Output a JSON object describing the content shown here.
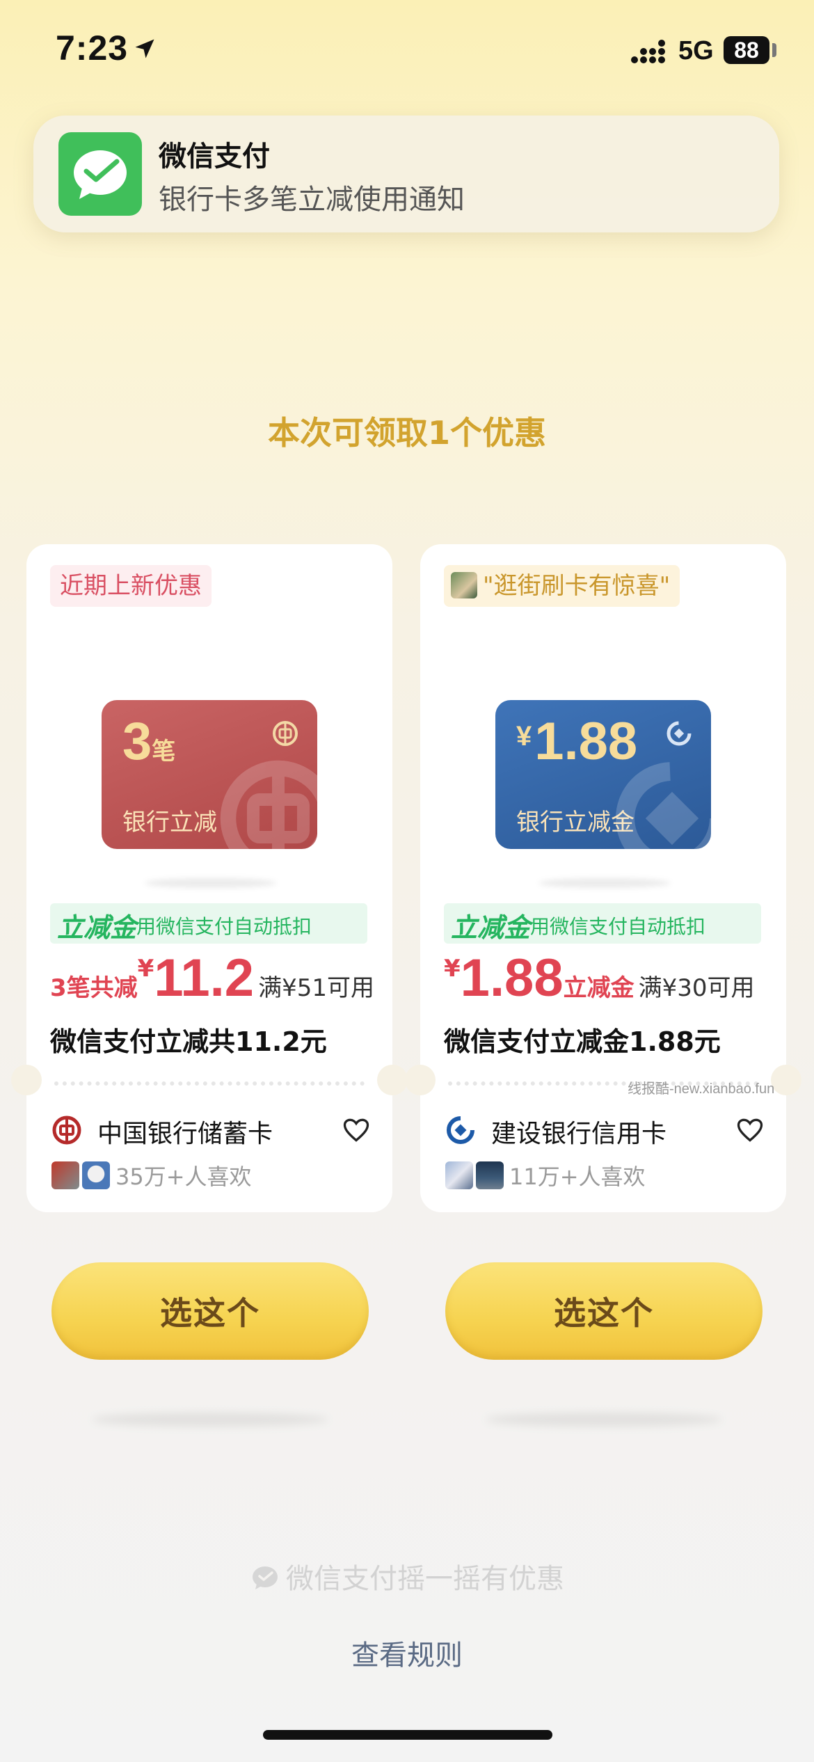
{
  "status_bar": {
    "time": "7:23",
    "network": "5G",
    "battery": "88"
  },
  "notification": {
    "title": "微信支付",
    "body": "银行卡多笔立减使用通知",
    "icon": "wechat-pay-icon",
    "icon_color": "#40bf5a"
  },
  "headline": "本次可领取1个优惠",
  "cards": [
    {
      "tag": "近期上新优惠",
      "bank_card_big": "3",
      "bank_card_big_small": "笔",
      "bank_card_label": "银行立减",
      "feature_strong": "立减金",
      "feature_sub": "用微信支付自动抵扣",
      "price_prefix": "3笔共减",
      "price_yen": "¥",
      "price_num": "11.2",
      "price_suffix": "",
      "price_cond": "满¥51可用",
      "desc": "微信支付立减共11.2元",
      "bank_name": "中国银行储蓄卡",
      "likes": "35万+人喜欢",
      "card_color": "#c05858"
    },
    {
      "tag": "\"逛街刷卡有惊喜\"",
      "bank_card_yen": "¥",
      "bank_card_big": "1.88",
      "bank_card_label": "银行立减金",
      "feature_strong": "立减金",
      "feature_sub": "用微信支付自动抵扣",
      "price_prefix": "",
      "price_yen": "¥",
      "price_num": "1.88",
      "price_suffix": "立减金",
      "price_cond": "满¥30可用",
      "desc": "微信支付立减金1.88元",
      "bank_name": "建设银行信用卡",
      "likes": "11万+人喜欢",
      "card_color": "#3768a8"
    }
  ],
  "choose_button_label": "选这个",
  "shake_text": "微信支付摇一摇有优惠",
  "rules_link": "查看规则",
  "watermark": "线报酷-new.xianbao.fun",
  "colors": {
    "headline": "#d2a32e",
    "price_red": "#e04452",
    "feature_green": "#25b55f",
    "button_yellow": "#f6d350"
  }
}
